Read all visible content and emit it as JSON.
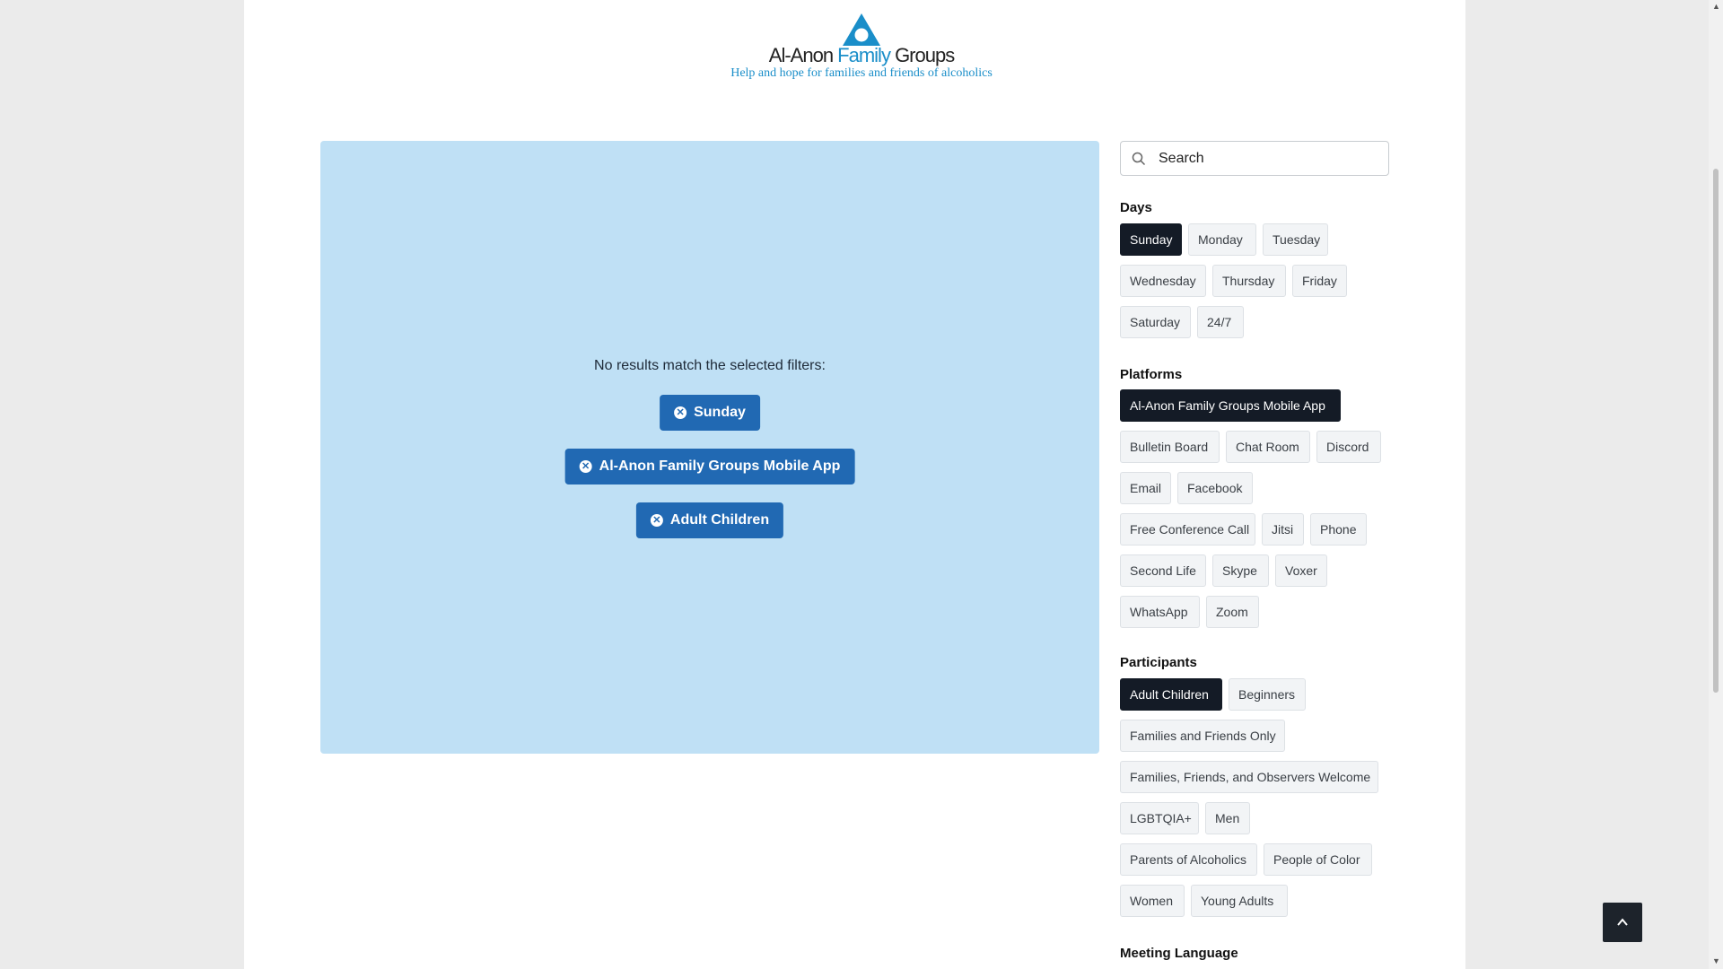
{
  "brand": {
    "name_part1": "Al-Anon ",
    "name_part2": "Family",
    "name_part3": " Groups",
    "tagline": "Help and hope for families and friends of alcoholics",
    "accent": "#1a8ec9"
  },
  "results": {
    "message": "No results match the selected filters:",
    "active_filters": [
      {
        "label": "Sunday"
      },
      {
        "label": "Al-Anon Family Groups Mobile App"
      },
      {
        "label": "Adult Children"
      }
    ],
    "bg": "#bfe0f5",
    "button_color": "#2169b3"
  },
  "search": {
    "placeholder": "Search",
    "icon": "search-icon"
  },
  "filters": {
    "days": {
      "title": "Days",
      "items": [
        "Sunday",
        "Monday",
        "Tuesday",
        "Wednesday",
        "Thursday",
        "Friday",
        "Saturday",
        "24/7"
      ],
      "selected": "Sunday"
    },
    "platforms": {
      "title": "Platforms",
      "items": [
        "Al-Anon Family Groups Mobile App",
        "Bulletin Board",
        "Chat Room",
        "Discord",
        "Email",
        "Facebook",
        "Free Conference Call",
        "Jitsi",
        "Phone",
        "Second Life",
        "Skype",
        "Voxer",
        "WhatsApp",
        "Zoom"
      ],
      "selected": "Al-Anon Family Groups Mobile App"
    },
    "participants": {
      "title": "Participants",
      "items": [
        "Adult Children",
        "Beginners",
        "Families and Friends Only",
        "Families, Friends, and Observers Welcome",
        "LGBTQIA+",
        "Men",
        "Parents of Alcoholics",
        "People of Color",
        "Women",
        "Young Adults"
      ],
      "selected": "Adult Children"
    },
    "language": {
      "title": "Meeting Language"
    }
  },
  "scroll_top": {
    "icon": "chevron-up-icon"
  }
}
